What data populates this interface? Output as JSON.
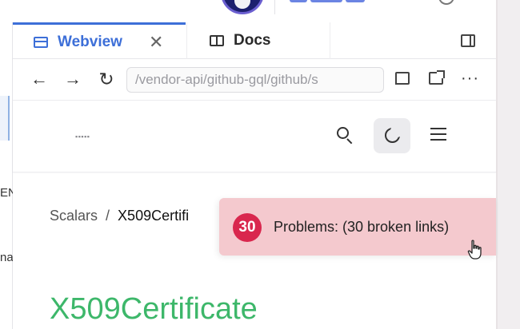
{
  "tabs": {
    "webview_label": "Webview",
    "docs_label": "Docs"
  },
  "address_bar": {
    "url": "/vendor-api/github-gql/github/s"
  },
  "webpage": {
    "breadcrumb": {
      "parent": "Scalars",
      "separator": "/",
      "current": "X509Certifi"
    },
    "title": "X509Certificate"
  },
  "problems_toast": {
    "count": "30",
    "message": "Problems: (30 broken links)"
  },
  "left_panel": {
    "fragment_1": "EN",
    "fragment_2": "na"
  },
  "colors": {
    "accent": "#3d6fd8",
    "title_green": "#3db76a",
    "toast_bg": "#f4c9ce",
    "toast_badge": "#d9274e"
  }
}
